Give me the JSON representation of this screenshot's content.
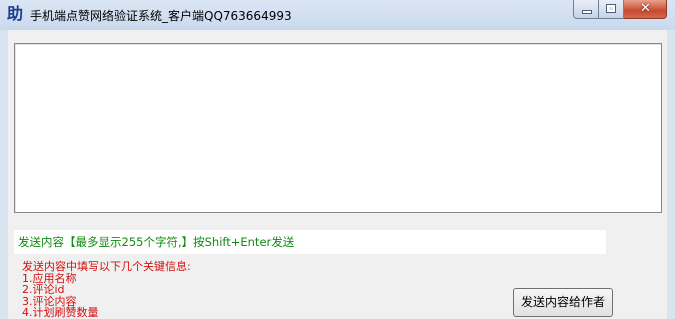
{
  "window": {
    "app_icon_glyph": "助",
    "title": "手机端点赞网络验证系统_客户端QQ763664993",
    "controls": {
      "minimize": "minimize-icon",
      "maximize": "maximize-icon",
      "close": "close-icon",
      "close_glyph": "✕"
    }
  },
  "main": {
    "output_text": "",
    "send_hint": "发送内容【最多显示255个字符,】按Shift+Enter发送",
    "info_lines": [
      "发送内容中填写以下几个关键信息:",
      "1.应用名称",
      "2.评论id",
      "3.评论内容",
      "4.计划刷赞数量"
    ],
    "send_button_label": "发送内容给作者"
  },
  "colors": {
    "hint_text": "#118a11",
    "info_text": "#d01010",
    "frame": "#d9e4f1"
  }
}
